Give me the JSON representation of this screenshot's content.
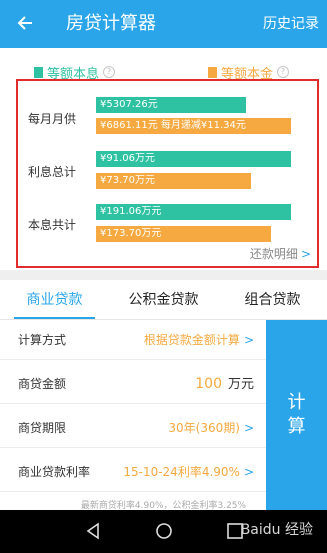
{
  "header": {
    "back_icon": "arrow-left-icon",
    "title": "房贷计算器",
    "history": "历史记录"
  },
  "legend": {
    "equal_interest": "等额本息",
    "equal_principal": "等额本金",
    "teal_color": "#2ec2a2",
    "orange_color": "#f5a940"
  },
  "summary_rows": [
    {
      "label": "每月月供",
      "teal": "¥5307.26元",
      "orange": "¥6861.11元  每月递减¥11.34元"
    },
    {
      "label": "利息总计",
      "teal": "¥91.06万元",
      "orange": "¥73.70万元"
    },
    {
      "label": "本息共计",
      "teal": "¥191.06万元",
      "orange": "¥173.70万元"
    }
  ],
  "detail_link": "还款明细",
  "tabs": [
    "商业贷款",
    "公积金贷款",
    "组合贷款"
  ],
  "form": {
    "calc_method": {
      "label": "计算方式",
      "value": "根据贷款金额计算"
    },
    "loan_amount": {
      "label": "商贷金额",
      "value": "100",
      "unit": "万元"
    },
    "loan_term": {
      "label": "商贷期限",
      "value": "30年(360期)"
    },
    "loan_rate": {
      "label": "商业贷款利率",
      "value": "15-10-24利率4.90%"
    }
  },
  "calc_button": {
    "line1": "计",
    "line2": "算"
  },
  "footnote": "最新商贷利率4.90%，公积金利率3.25%",
  "watermark": "Baidu 经验",
  "nav": {
    "back": "nav-back-icon",
    "home": "nav-home-icon",
    "recent": "nav-recent-icon"
  },
  "accent_color": "#2aa5ea"
}
